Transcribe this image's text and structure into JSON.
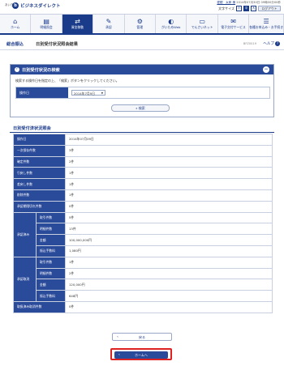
{
  "header": {
    "logo_mark": "あいぎん",
    "logo_text": "ビジネスダイレクト",
    "logo_sub": "BUSINESS DIRECT",
    "user_name": "愛銀　太郎 様",
    "last_login": "2014年07月30日 09時00分00秒",
    "font_size_label": "文字サイズ",
    "font_sizes": [
      "小",
      "中",
      "大"
    ],
    "logout_label": "ログアウト"
  },
  "global_nav": [
    {
      "icon": "home-icon",
      "glyph": "⌂",
      "label": "ホーム"
    },
    {
      "icon": "statement-icon",
      "glyph": "▤",
      "label": "明細照会"
    },
    {
      "icon": "transfer-icon",
      "glyph": "⇄",
      "label": "資金移動"
    },
    {
      "icon": "approval-icon",
      "glyph": "✎",
      "label": "承認"
    },
    {
      "icon": "admin-icon",
      "glyph": "⚙",
      "label": "管理"
    },
    {
      "icon": "web-icon",
      "glyph": "◐",
      "label": "がいためWeb"
    },
    {
      "icon": "densai-icon",
      "glyph": "▭",
      "label": "でんさいネット"
    },
    {
      "icon": "e-delivery-icon",
      "glyph": "✉",
      "label": "電子交付サービス"
    },
    {
      "icon": "application-icon",
      "glyph": "☰",
      "label": "各種お申込み・お手続き"
    }
  ],
  "page": {
    "category": "総合振込",
    "title": "日別受付状況照会結果",
    "screen_id": "BFZ0019",
    "help_label": "ヘルプ"
  },
  "search_panel": {
    "title": "日別受付状況の検索",
    "description": "検索する操作日を指定の上、「検索」ボタンをクリックしてください。",
    "date_label": "操作日",
    "date_value": "2014年7月9日",
    "search_label": "検索"
  },
  "result": {
    "title": "日別受付済状況照会",
    "operation_date_label": "操作日",
    "operation_date_value": "2014年07月09日",
    "temp_saved_label": "一次保存件数",
    "temp_saved_value": "3件",
    "confirmed_label": "確定件数",
    "confirmed_value": "2件",
    "withdrawn_label": "引戻し件数",
    "withdrawn_value": "1件",
    "returned_label": "差戻し件数",
    "returned_value": "1件",
    "deleted_label": "削除件数",
    "deleted_value": "1件",
    "approval_waiting_label": "承認期限切れ件数",
    "approval_waiting_value": "0件",
    "accepted_group_label": "承認済み",
    "accepted_count_label": "取引件数",
    "accepted_count_value": "5件",
    "accepted_detail_label": "明細件数",
    "accepted_detail_value": "13件",
    "accepted_amount_label": "金額",
    "accepted_amount_value": "100,000,000円",
    "accepted_fee_label": "振込手数料",
    "accepted_fee_value": "1,080円",
    "cancelled_group_label": "承認取消",
    "cancelled_count_label": "取引件数",
    "cancelled_count_value": "1件",
    "cancelled_detail_label": "明細件数",
    "cancelled_detail_value": "2件",
    "cancelled_amount_label": "金額",
    "cancelled_amount_value": "120,000円",
    "cancelled_fee_label": "振込手数料",
    "cancelled_fee_value": "648円",
    "reservation_cancel_label": "取扱済み取消件数",
    "reservation_cancel_value": "0件"
  },
  "buttons": {
    "back_label": "戻る",
    "home_label": "ホームへ"
  },
  "colors": {
    "brand": "#1a3a8a",
    "panel_header": "#2a4a9a",
    "highlight": "#dd2222"
  }
}
